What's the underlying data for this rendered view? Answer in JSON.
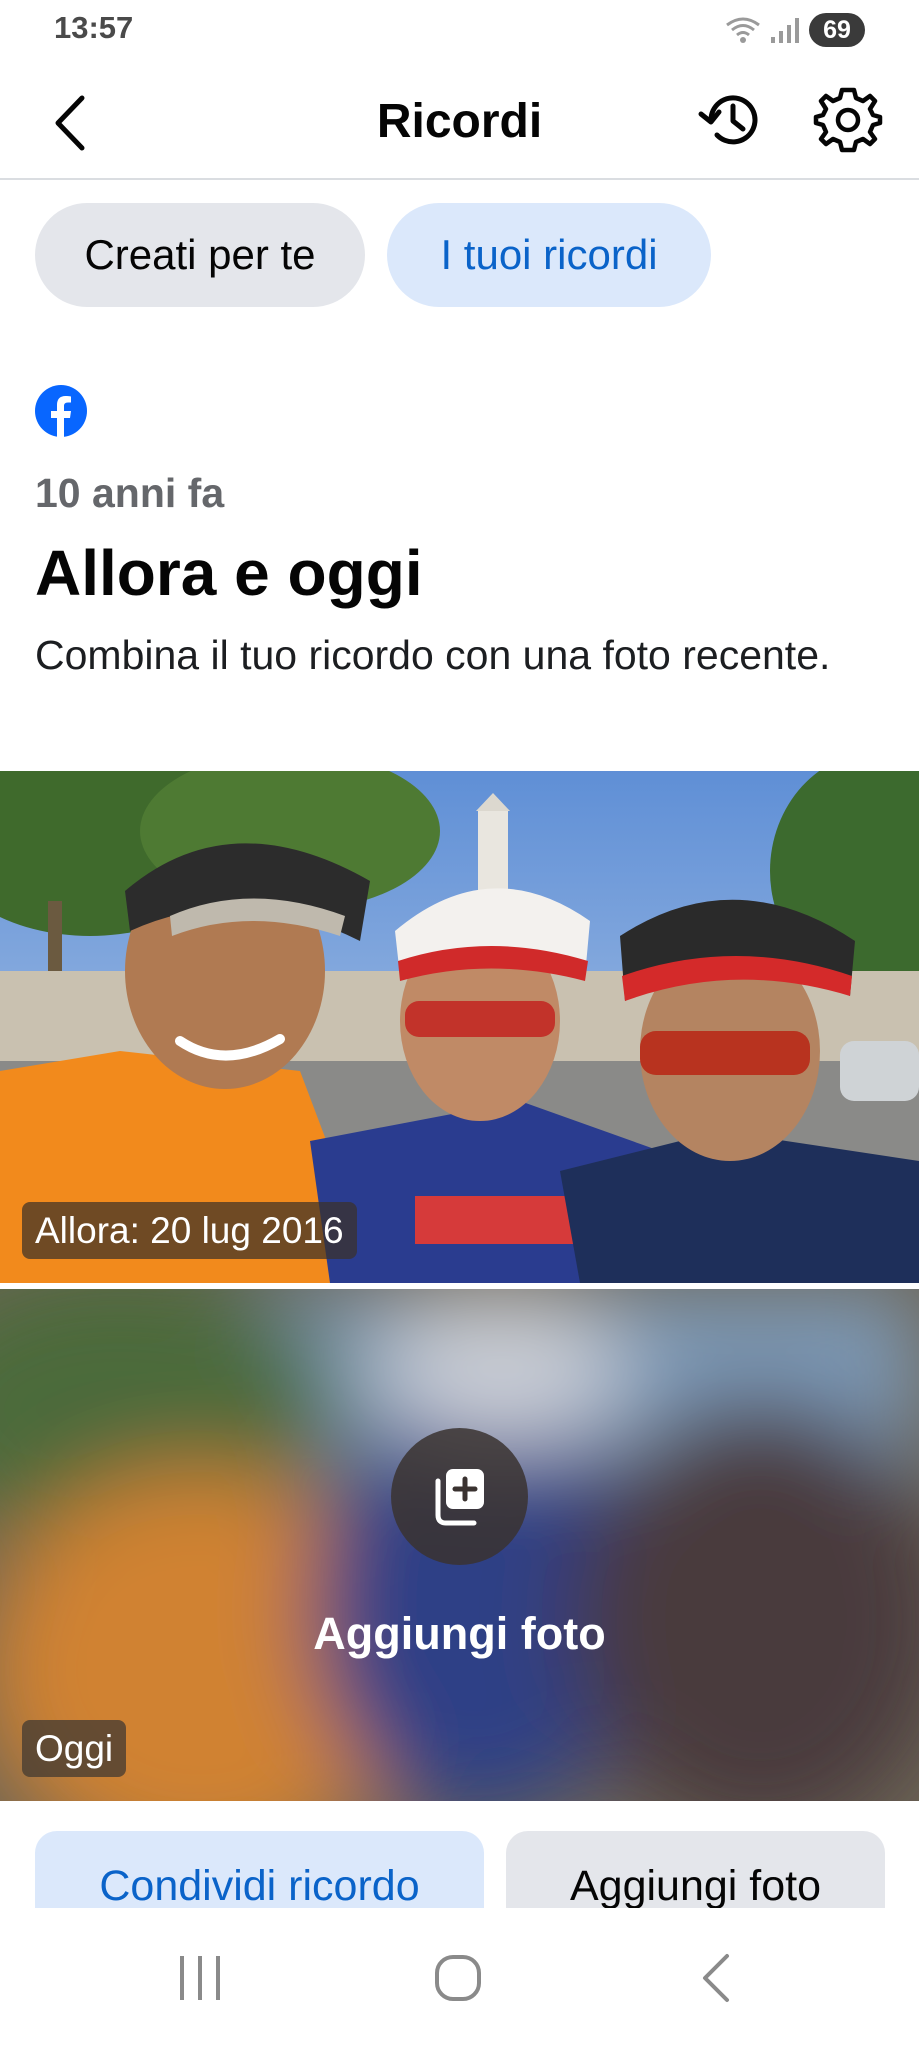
{
  "status_bar": {
    "time": "13:57",
    "battery": "69",
    "icons": [
      "wifi-icon",
      "signal-icon",
      "battery-icon"
    ]
  },
  "header": {
    "title": "Ricordi",
    "icons": [
      "back-arrow-icon",
      "history-clock-icon",
      "gear-icon"
    ]
  },
  "tabs": [
    {
      "label": "Creati per te",
      "selected": false
    },
    {
      "label": "I tuoi ricordi",
      "selected": true
    }
  ],
  "memory": {
    "source_icon": "facebook-logo-icon",
    "years_ago": "10 anni fa",
    "title": "Allora e oggi",
    "description": "Combina il tuo ricordo con una foto recente.",
    "then_label": "Allora: 20 lug 2016",
    "add_photo_prompt": "Aggiungi foto",
    "today_label": "Oggi"
  },
  "actions": {
    "share": "Condividi ricordo",
    "add_photo": "Aggiungi foto"
  },
  "nav_bar": {
    "icons": [
      "recents-icon",
      "home-icon",
      "back-icon"
    ]
  },
  "colors": {
    "facebook_blue": "#0866ff",
    "selected_tab_bg": "#dbe8fb",
    "selected_tab_text": "#0a63c9",
    "neutral_button_bg": "#e4e6eb",
    "secondary_text": "#65676b"
  }
}
